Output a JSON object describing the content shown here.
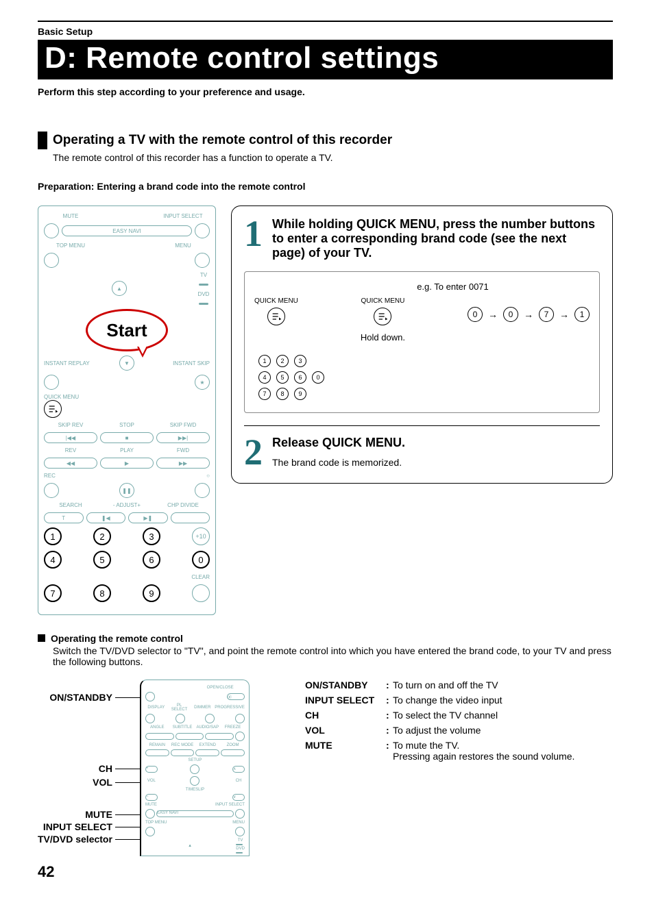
{
  "header": {
    "section": "Basic Setup"
  },
  "title": "D: Remote control settings",
  "subtitle": "Perform this step according to your preference and usage.",
  "operating": {
    "heading": "Operating a TV with the remote control of this recorder",
    "desc": "The remote control of this recorder has a function to operate a TV."
  },
  "preparation": "Preparation: Entering a brand code into the remote control",
  "remote": {
    "mute": "MUTE",
    "input_select": "INPUT SELECT",
    "top_menu": "TOP MENU",
    "easy_navi": "EASY NAVI",
    "menu": "MENU",
    "tv": "TV",
    "dvd": "DVD",
    "start": "Start",
    "instant_replay": "INSTANT REPLAY",
    "instant_skip": "INSTANT SKIP",
    "quick_menu": "QUICK MENU",
    "skip_rev": "SKIP REV",
    "stop": "STOP",
    "skip_fwd": "SKIP FWD",
    "rev": "REV",
    "play": "PLAY",
    "fwd": "FWD",
    "rec": "REC",
    "search": "SEARCH",
    "adjust": "- ADJUST+",
    "chp_divide": "CHP DIVIDE",
    "t": "T",
    "clear": "CLEAR",
    "plus10": "+10",
    "n1": "1",
    "n2": "2",
    "n3": "3",
    "n4": "4",
    "n5": "5",
    "n6": "6",
    "n7": "7",
    "n8": "8",
    "n9": "9",
    "n0": "0"
  },
  "step1": {
    "title": "While holding QUICK MENU, press the number buttons to enter a corresponding brand code (see the next page) of your TV.",
    "eg_label": "e.g. To enter 0071",
    "quick_menu": "QUICK MENU",
    "hold_down": "Hold down.",
    "seq": [
      "0",
      "0",
      "7",
      "1"
    ]
  },
  "step2": {
    "title": "Release QUICK MENU.",
    "desc": "The brand code is memorized."
  },
  "orc": {
    "title": "Operating the remote control",
    "desc": "Switch the TV/DVD selector to \"TV\", and point the remote control into which you have entered the brand code, to your TV and press the following buttons."
  },
  "labels": {
    "on_standby": "ON/STANDBY",
    "ch": "CH",
    "vol": "VOL",
    "mute": "MUTE",
    "input_select": "INPUT SELECT",
    "selector": "TV/DVD selector"
  },
  "mini": {
    "open_close": "OPEN/CLOSE",
    "display": "DISPLAY",
    "pl_select": "PL SELECT",
    "dimmer": "DIMMER",
    "progressive": "PROGRESSIVE",
    "angle": "ANGLE",
    "subtitle": "SUBTITLE",
    "audio": "AUDIO/SAP",
    "freeze": "FREEZE",
    "remain": "REMAIN",
    "recmode": "REC MODE",
    "extend": "EXTEND",
    "zoom": "ZOOM",
    "setup": "SETUP",
    "timeslip": "TIMESLIP",
    "ch": "CH",
    "vol": "VOL",
    "mute": "MUTE",
    "input_select": "INPUT SELECT",
    "top_menu": "TOP MENU",
    "easy_navi": "EASY NAVI",
    "menu": "MENU",
    "tv": "TV",
    "dvd": "DVD"
  },
  "definitions": {
    "on_standby": {
      "term": "ON/STANDBY",
      "body": "To turn on and off the TV"
    },
    "input_select": {
      "term": "INPUT SELECT",
      "body": "To change the video input"
    },
    "ch": {
      "term": "CH",
      "body": "To select the TV channel"
    },
    "vol": {
      "term": "VOL",
      "body": "To adjust the volume"
    },
    "mute": {
      "term": "MUTE",
      "body1": "To mute the TV.",
      "body2": "Pressing again restores the sound volume."
    }
  },
  "page": "42"
}
